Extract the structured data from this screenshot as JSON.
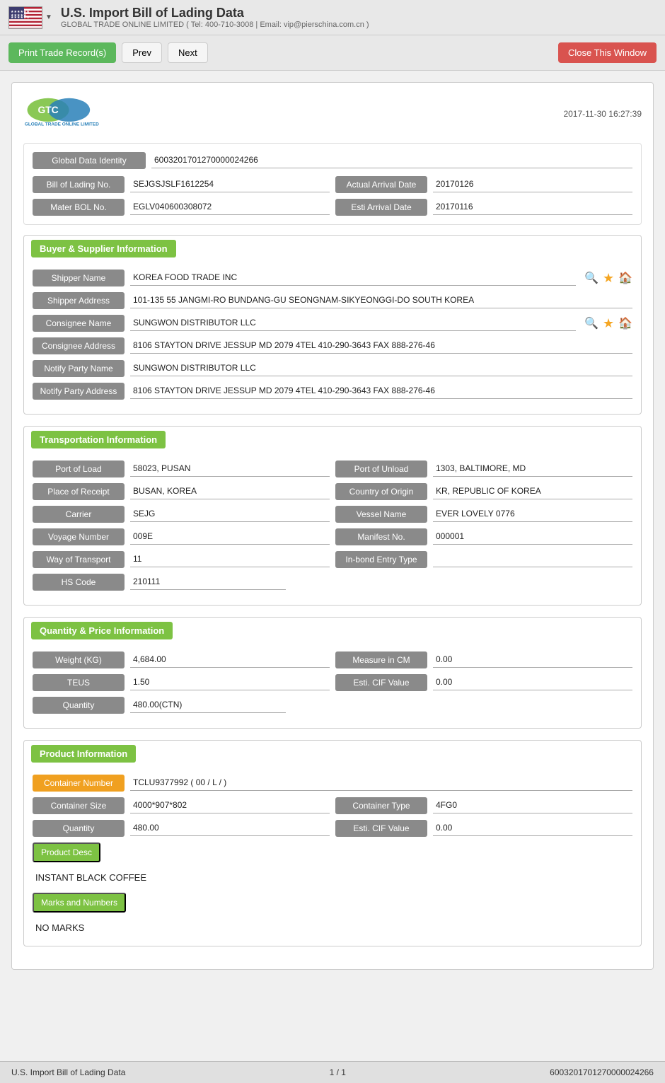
{
  "header": {
    "title": "U.S. Import Bill of Lading Data",
    "dropdown_arrow": "▼",
    "subtitle": "GLOBAL TRADE ONLINE LIMITED ( Tel: 400-710-3008 | Email: vip@pierschina.com.cn )",
    "flag_alt": "US Flag"
  },
  "toolbar": {
    "print_label": "Print Trade Record(s)",
    "prev_label": "Prev",
    "next_label": "Next",
    "close_label": "Close This Window"
  },
  "record": {
    "timestamp": "2017-11-30 16:27:39",
    "logo_company": "GLOBAL TRADE ONLINE LIMITED",
    "global_data_identity_label": "Global Data Identity",
    "global_data_identity_value": "6003201701270000024266",
    "bill_of_lading_label": "Bill of Lading No.",
    "bill_of_lading_value": "SEJGSJSLF1612254",
    "actual_arrival_date_label": "Actual Arrival Date",
    "actual_arrival_date_value": "20170126",
    "mater_bol_label": "Mater BOL No.",
    "mater_bol_value": "EGLV040600308072",
    "esti_arrival_date_label": "Esti Arrival Date",
    "esti_arrival_date_value": "20170116"
  },
  "buyer_supplier": {
    "section_title": "Buyer & Supplier Information",
    "shipper_name_label": "Shipper Name",
    "shipper_name_value": "KOREA FOOD TRADE INC",
    "shipper_address_label": "Shipper Address",
    "shipper_address_value": "101-135 55 JANGMI-RO BUNDANG-GU SEONGNAM-SIKYEONGGI-DO SOUTH KOREA",
    "consignee_name_label": "Consignee Name",
    "consignee_name_value": "SUNGWON DISTRIBUTOR LLC",
    "consignee_address_label": "Consignee Address",
    "consignee_address_value": "8106 STAYTON DRIVE JESSUP MD 2079 4TEL 410-290-3643 FAX 888-276-46",
    "notify_party_name_label": "Notify Party Name",
    "notify_party_name_value": "SUNGWON DISTRIBUTOR LLC",
    "notify_party_address_label": "Notify Party Address",
    "notify_party_address_value": "8106 STAYTON DRIVE JESSUP MD 2079 4TEL 410-290-3643 FAX 888-276-46"
  },
  "transportation": {
    "section_title": "Transportation Information",
    "port_of_load_label": "Port of Load",
    "port_of_load_value": "58023, PUSAN",
    "port_of_unload_label": "Port of Unload",
    "port_of_unload_value": "1303, BALTIMORE, MD",
    "place_of_receipt_label": "Place of Receipt",
    "place_of_receipt_value": "BUSAN, KOREA",
    "country_of_origin_label": "Country of Origin",
    "country_of_origin_value": "KR, REPUBLIC OF KOREA",
    "carrier_label": "Carrier",
    "carrier_value": "SEJG",
    "vessel_name_label": "Vessel Name",
    "vessel_name_value": "EVER LOVELY 0776",
    "voyage_number_label": "Voyage Number",
    "voyage_number_value": "009E",
    "manifest_no_label": "Manifest No.",
    "manifest_no_value": "000001",
    "way_of_transport_label": "Way of Transport",
    "way_of_transport_value": "11",
    "in_bond_entry_label": "In-bond Entry Type",
    "in_bond_entry_value": "",
    "hs_code_label": "HS Code",
    "hs_code_value": "210111"
  },
  "quantity_price": {
    "section_title": "Quantity & Price Information",
    "weight_label": "Weight (KG)",
    "weight_value": "4,684.00",
    "measure_label": "Measure in CM",
    "measure_value": "0.00",
    "teus_label": "TEUS",
    "teus_value": "1.50",
    "esti_cif_label": "Esti. CIF Value",
    "esti_cif_value": "0.00",
    "quantity_label": "Quantity",
    "quantity_value": "480.00(CTN)"
  },
  "product_info": {
    "section_title": "Product Information",
    "container_number_label": "Container Number",
    "container_number_value": "TCLU9377992 ( 00 / L / )",
    "container_size_label": "Container Size",
    "container_size_value": "4000*907*802",
    "container_type_label": "Container Type",
    "container_type_value": "4FG0",
    "quantity_label": "Quantity",
    "quantity_value": "480.00",
    "esti_cif_label": "Esti. CIF Value",
    "esti_cif_value": "0.00",
    "product_desc_label": "Product Desc",
    "product_desc_text": "INSTANT BLACK COFFEE",
    "marks_numbers_label": "Marks and Numbers",
    "marks_numbers_text": "NO MARKS"
  },
  "footer": {
    "left_text": "U.S. Import Bill of Lading Data",
    "center_text": "1 / 1",
    "right_text": "6003201701270000024266"
  }
}
